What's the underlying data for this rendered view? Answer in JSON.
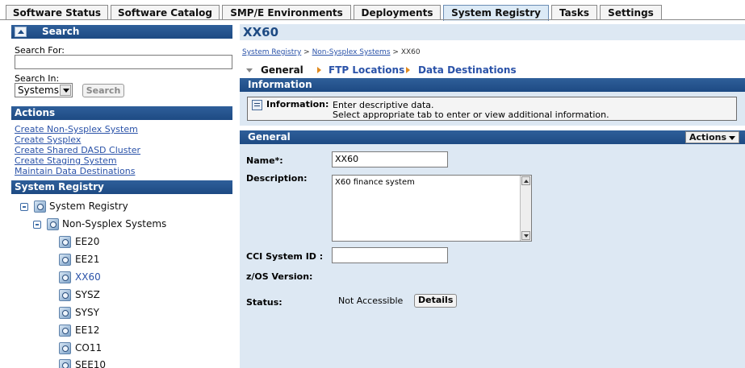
{
  "tabs": [
    {
      "label": "Software Status",
      "active": false
    },
    {
      "label": "Software Catalog",
      "active": false
    },
    {
      "label": "SMP/E Environments",
      "active": false
    },
    {
      "label": "Deployments",
      "active": false
    },
    {
      "label": "System Registry",
      "active": true
    },
    {
      "label": "Tasks",
      "active": false
    },
    {
      "label": "Settings",
      "active": false
    }
  ],
  "search": {
    "title": "Search",
    "search_for_label": "Search For:",
    "search_for_value": "",
    "search_in_label": "Search In:",
    "search_in_value": "Systems",
    "button_label": "Search"
  },
  "actions": {
    "title": "Actions",
    "links": [
      "Create Non-Sysplex System",
      "Create Sysplex",
      "Create Shared DASD Cluster",
      "Create Staging System",
      "Maintain Data Destinations"
    ]
  },
  "registry": {
    "title": "System Registry",
    "root": "System Registry",
    "group": "Non-Sysplex Systems",
    "systems": [
      "EE20",
      "EE21",
      "XX60",
      "SYSZ",
      "SYSY",
      "EE12",
      "CO11",
      "SEE10"
    ],
    "selected": "XX60"
  },
  "page": {
    "title": "XX60",
    "breadcrumb": [
      "System Registry",
      "Non-Sysplex Systems",
      "XX60"
    ],
    "breadcrumb_separator": ">",
    "subtabs": [
      "General",
      "FTP Locations",
      "Data Destinations"
    ],
    "current_subtab": "General"
  },
  "information": {
    "header": "Information",
    "label": "Information:",
    "line1": "Enter descriptive data.",
    "line2": "Select appropriate tab to enter or view additional information."
  },
  "general": {
    "header": "General",
    "actions_button": "Actions",
    "name_label": "Name*:",
    "name_value": "XX60",
    "description_label": "Description:",
    "description_value": "X60 finance system",
    "cci_label": "CCI System ID :",
    "cci_value": "",
    "zos_label": "z/OS Version:",
    "zos_value": "",
    "status_label": "Status:",
    "status_value": "Not Accessible",
    "details_button": "Details"
  },
  "colors": {
    "header_blue": "#1d4a83",
    "panel_bg": "#dde8f3",
    "link": "#2a52a8",
    "subtab_separator": "#e08a1e"
  }
}
